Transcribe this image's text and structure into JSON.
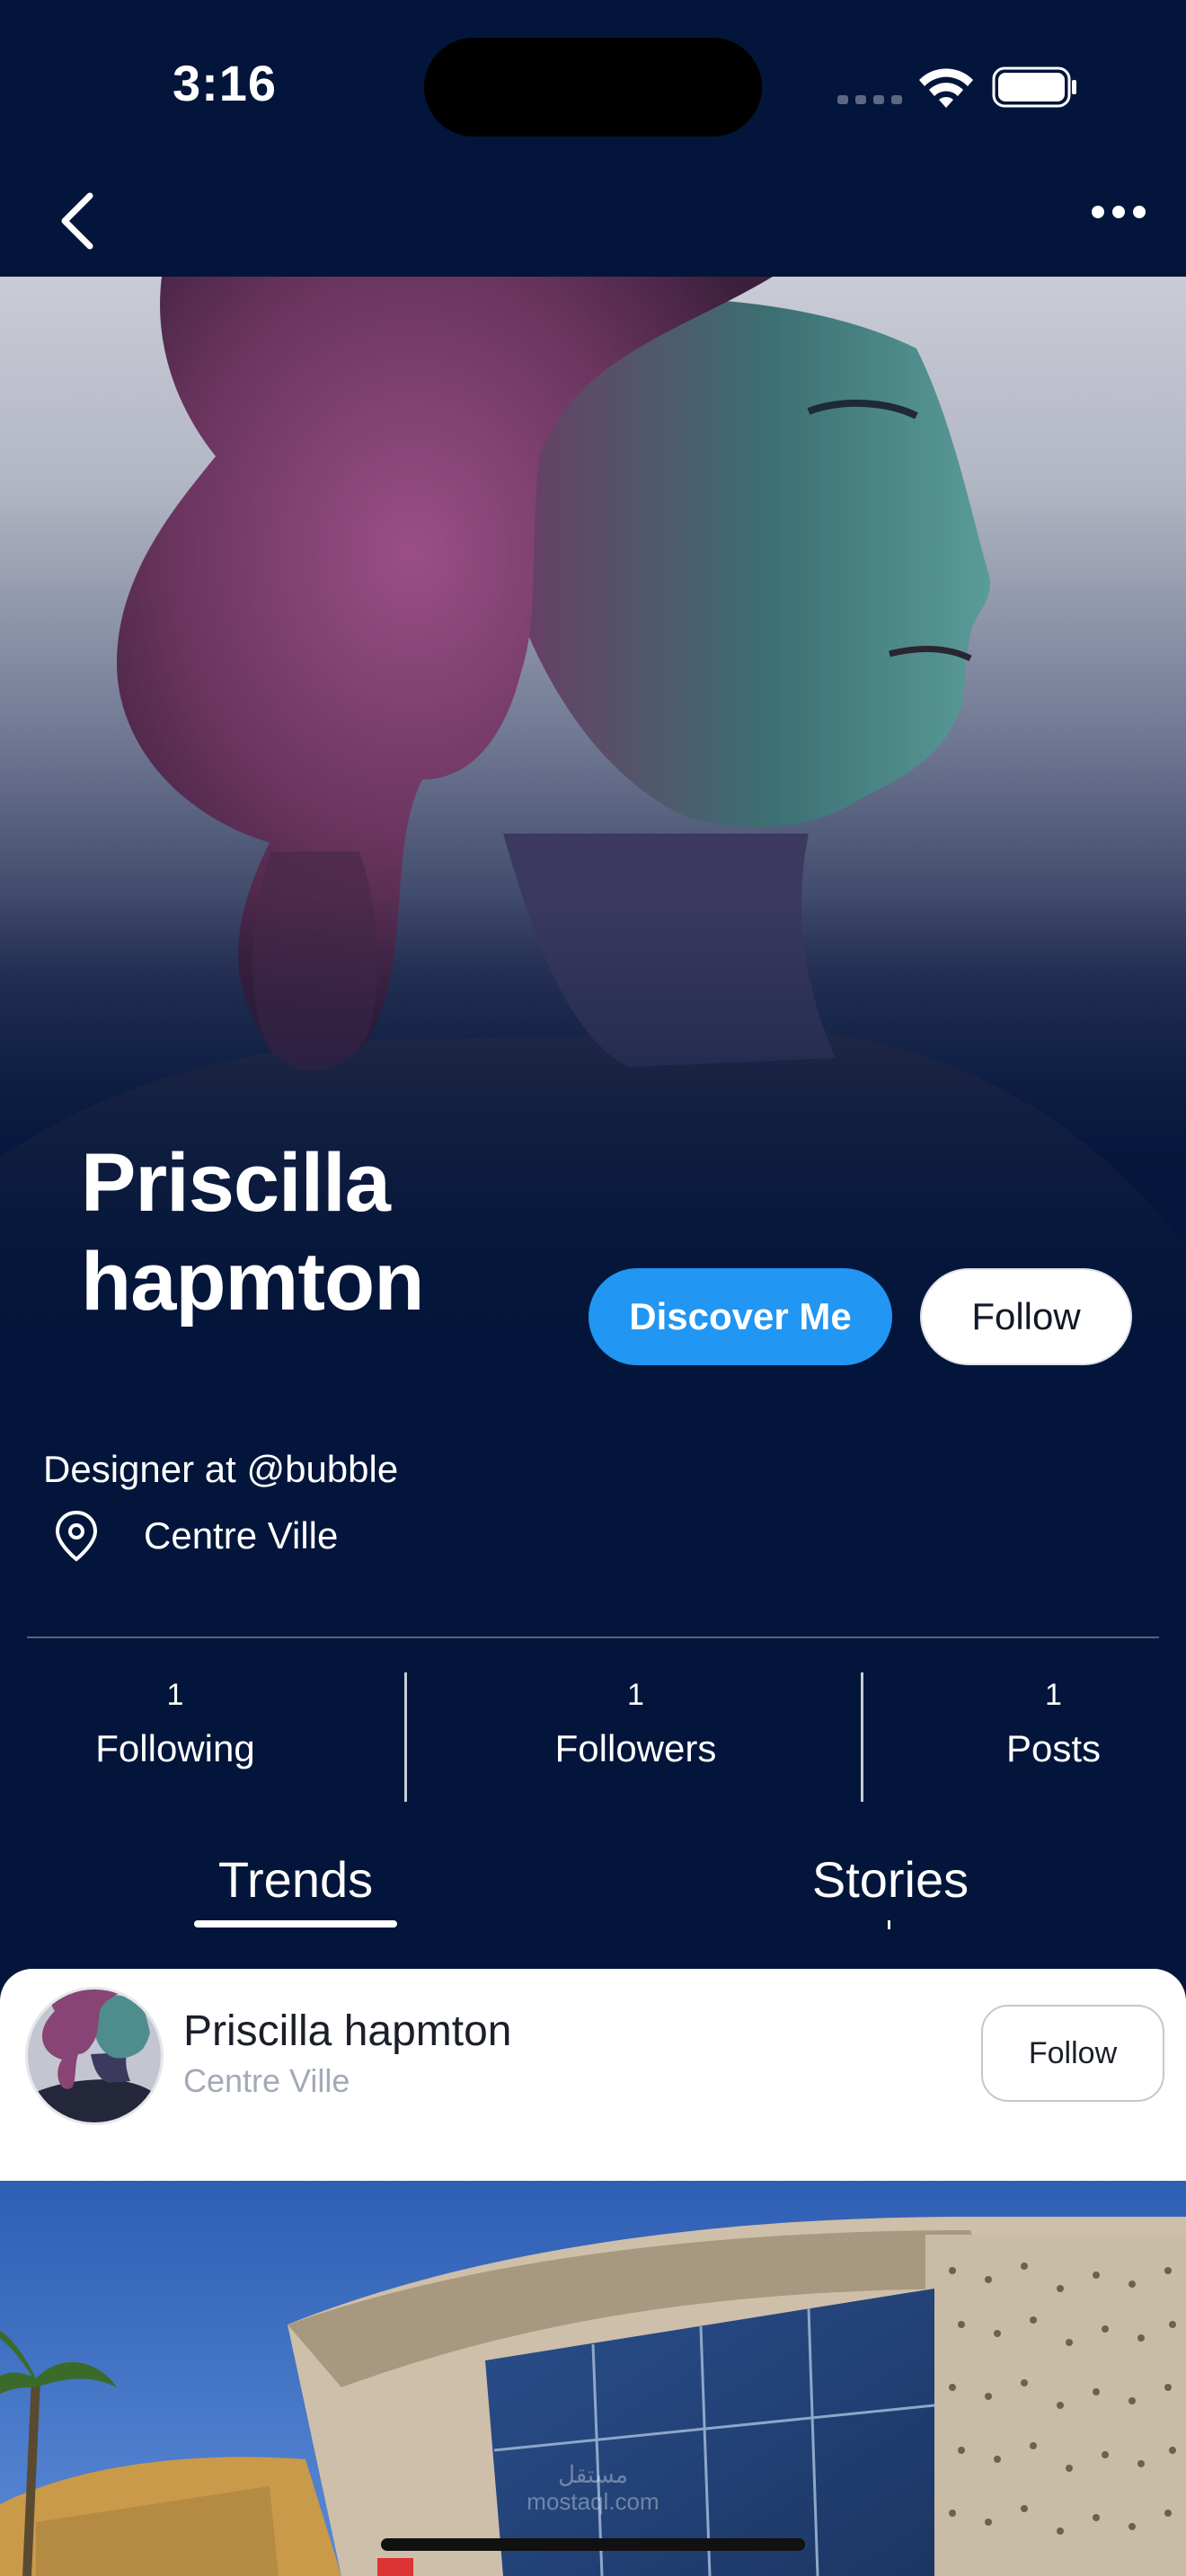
{
  "status_bar": {
    "time": "3:16"
  },
  "profile": {
    "first_name": "Priscilla",
    "last_name": "hapmton",
    "bio": "Designer at @bubble",
    "location": "Centre Ville"
  },
  "actions": {
    "discover_label": "Discover Me",
    "follow_label": "Follow"
  },
  "stats": [
    {
      "count": "1",
      "label": "Following"
    },
    {
      "count": "1",
      "label": "Followers"
    },
    {
      "count": "1",
      "label": "Posts"
    }
  ],
  "tabs": [
    {
      "label": "Trends",
      "active": true
    },
    {
      "label": "Stories",
      "active": false
    }
  ],
  "post": {
    "author": "Priscilla hapmton",
    "location": "Centre Ville",
    "follow_label": "Follow"
  },
  "watermark": {
    "arabic": "مستقل",
    "latin": "mostaql.com"
  },
  "colors": {
    "background": "#03153a",
    "accent": "#2196f3",
    "card": "#ffffff"
  }
}
